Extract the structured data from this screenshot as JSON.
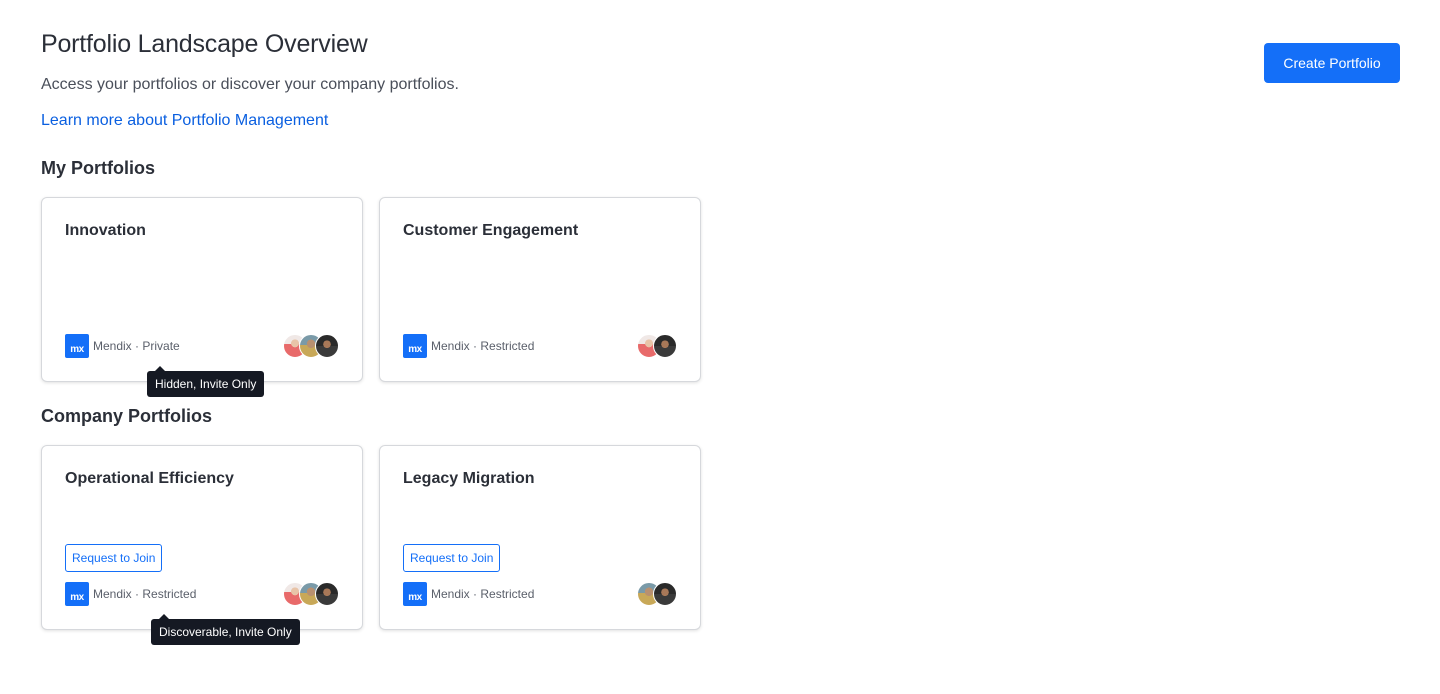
{
  "header": {
    "title": "Portfolio Landscape Overview",
    "subtitle": "Access your portfolios or discover your company portfolios.",
    "learn_link": "Learn more about Portfolio Management",
    "create_button": "Create Portfolio"
  },
  "my_portfolios": {
    "title": "My Portfolios",
    "cards": [
      {
        "name": "Innovation",
        "logo": "mx",
        "meta": "Mendix · Private"
      },
      {
        "name": "Customer Engagement",
        "logo": "mx",
        "meta": "Mendix · Restricted"
      }
    ]
  },
  "company_portfolios": {
    "title": "Company Portfolios",
    "cards": [
      {
        "name": "Operational Efficiency",
        "logo": "mx",
        "meta": "Mendix · Restricted",
        "action": "Request to Join"
      },
      {
        "name": "Legacy Migration",
        "logo": "mx",
        "meta": "Mendix · Restricted",
        "action": "Request to Join"
      }
    ]
  },
  "tooltips": {
    "private": "Hidden, Invite Only",
    "restricted": "Discoverable, Invite Only"
  },
  "colors": {
    "primary": "#146ff8",
    "link": "#0a5fe0",
    "tooltip_bg": "#151923"
  }
}
